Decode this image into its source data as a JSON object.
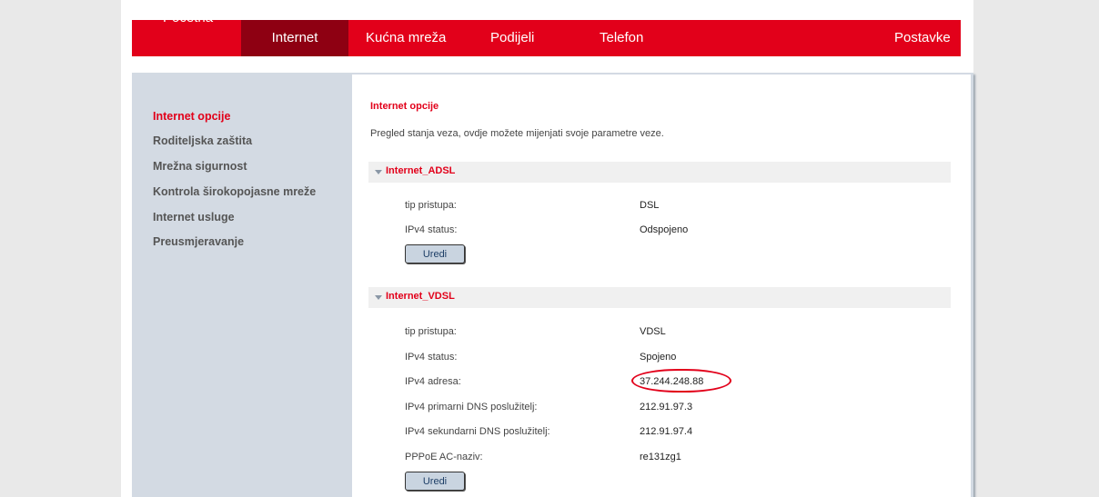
{
  "nav": {
    "items": [
      "Početna",
      "Internet",
      "Kućna mreža",
      "Podijeli",
      "Telefon"
    ],
    "settings": "Postavke",
    "active": "Internet"
  },
  "sidebar": {
    "items": [
      "Internet opcije",
      "Roditeljska zaštita",
      "Mrežna sigurnost",
      "Kontrola širokopojasne mreže",
      "Internet usluge",
      "Preusmjeravanje"
    ],
    "active": "Internet opcije"
  },
  "content": {
    "title": "Internet opcije",
    "description": "Pregled stanja veza, ovdje možete mijenjati svoje parametre veze."
  },
  "sections": [
    {
      "name": "Internet_ADSL",
      "fields": [
        {
          "label": "tip pristupa:",
          "value": "DSL"
        },
        {
          "label": "IPv4 status:",
          "value": "Odspojeno"
        }
      ],
      "button": "Uredi"
    },
    {
      "name": "Internet_VDSL",
      "fields": [
        {
          "label": "tip pristupa:",
          "value": "VDSL"
        },
        {
          "label": "IPv4 status:",
          "value": "Spojeno"
        },
        {
          "label": "IPv4 adresa:",
          "value": "37.244.248.88"
        },
        {
          "label": "IPv4 primarni DNS poslužitelj:",
          "value": "212.91.97.3"
        },
        {
          "label": "IPv4 sekundarni DNS poslužitelj:",
          "value": "212.91.97.4"
        },
        {
          "label": "PPPoE AC-naziv:",
          "value": "re131zg1"
        }
      ],
      "button": "Uredi"
    }
  ],
  "annotation": {
    "highlighted_value": "37.244.248.88",
    "color": "#e2001a"
  },
  "colors": {
    "brand": "#e2001a",
    "nav_active": "#8e0012",
    "sidebar_bg": "#d3dae3",
    "button_bg": "#c9d4e0"
  }
}
